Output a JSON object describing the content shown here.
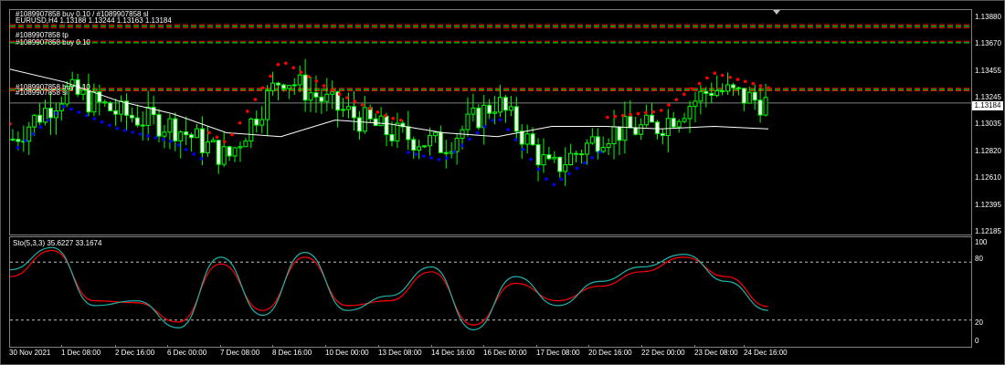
{
  "window": {
    "symbol_timeframe": "EURUSD,H4",
    "ohlc_text": "EURUSD,H4 1.13188 1.13244 1.13163 1.13184",
    "order_lines": [
      "#1089907858 sl",
      "#1089907858 buy 0.10",
      "#1089907858 tp",
      "#1089907858 buy 0.10"
    ],
    "order_line_stacked": "#1089907858 buy 0.10 / #1089907858 sl"
  },
  "price_axis": {
    "ticks": [
      "1.13880",
      "1.13670",
      "1.13455",
      "1.13245",
      "1.13035",
      "1.12820",
      "1.12610",
      "1.12395",
      "1.12185"
    ],
    "current_price": "1.13184"
  },
  "oscillator": {
    "label": "Sto(5,3,3) 35.6227 33.1674",
    "levels": [
      "100",
      "80",
      "20",
      "0"
    ]
  },
  "time_axis": {
    "labels": [
      "30 Nov 2021",
      "1 Dec 08:00",
      "2 Dec 16:00",
      "6 Dec 00:00",
      "7 Dec 08:00",
      "8 Dec 16:00",
      "10 Dec 00:00",
      "13 Dec 08:00",
      "14 Dec 16:00",
      "16 Dec 00:00",
      "17 Dec 08:00",
      "20 Dec 16:00",
      "22 Dec 00:00",
      "23 Dec 08:00",
      "24 Dec 16:00"
    ]
  },
  "colors": {
    "background": "#000000",
    "candle_outline": "#00ff00",
    "candle_bull_fill": "#000000",
    "candle_bear_fill": "#ffffff",
    "moving_average": "#ffffff",
    "sar_up": "#0000ff",
    "sar_down": "#ff0000",
    "order_line_red": "#ff0000",
    "order_line_green": "#00ff00",
    "stoch_main": "#20b2aa",
    "stoch_signal": "#ff0000"
  },
  "chart_data": {
    "type": "candlestick",
    "x": [
      "30 Nov 2021",
      "1 Dec 08:00",
      "2 Dec 16:00",
      "6 Dec 00:00",
      "7 Dec 08:00",
      "8 Dec 16:00",
      "10 Dec 00:00",
      "13 Dec 08:00",
      "14 Dec 16:00",
      "16 Dec 00:00",
      "17 Dec 08:00",
      "20 Dec 16:00",
      "22 Dec 00:00",
      "23 Dec 08:00",
      "24 Dec 16:00"
    ],
    "ylim": [
      1.12185,
      1.1388
    ],
    "close_series": [
      1.129,
      1.1328,
      1.131,
      1.13,
      1.1275,
      1.134,
      1.1315,
      1.1295,
      1.1285,
      1.132,
      1.1265,
      1.1295,
      1.13,
      1.133,
      1.13184
    ],
    "moving_average": [
      1.1345,
      1.1335,
      1.132,
      1.131,
      1.1295,
      1.1292,
      1.1305,
      1.1302,
      1.1295,
      1.1292,
      1.13,
      1.13,
      1.1298,
      1.13,
      1.1298
    ],
    "order_levels": [
      1.138,
      1.1367,
      1.133
    ],
    "stochastic": {
      "main": [
        72,
        95,
        35,
        40,
        12,
        85,
        25,
        90,
        30,
        45,
        75,
        10,
        65,
        35,
        60,
        75,
        88,
        60,
        30
      ],
      "signal": [
        65,
        92,
        40,
        38,
        18,
        78,
        30,
        85,
        35,
        40,
        70,
        15,
        58,
        40,
        55,
        70,
        85,
        65,
        34
      ]
    }
  }
}
